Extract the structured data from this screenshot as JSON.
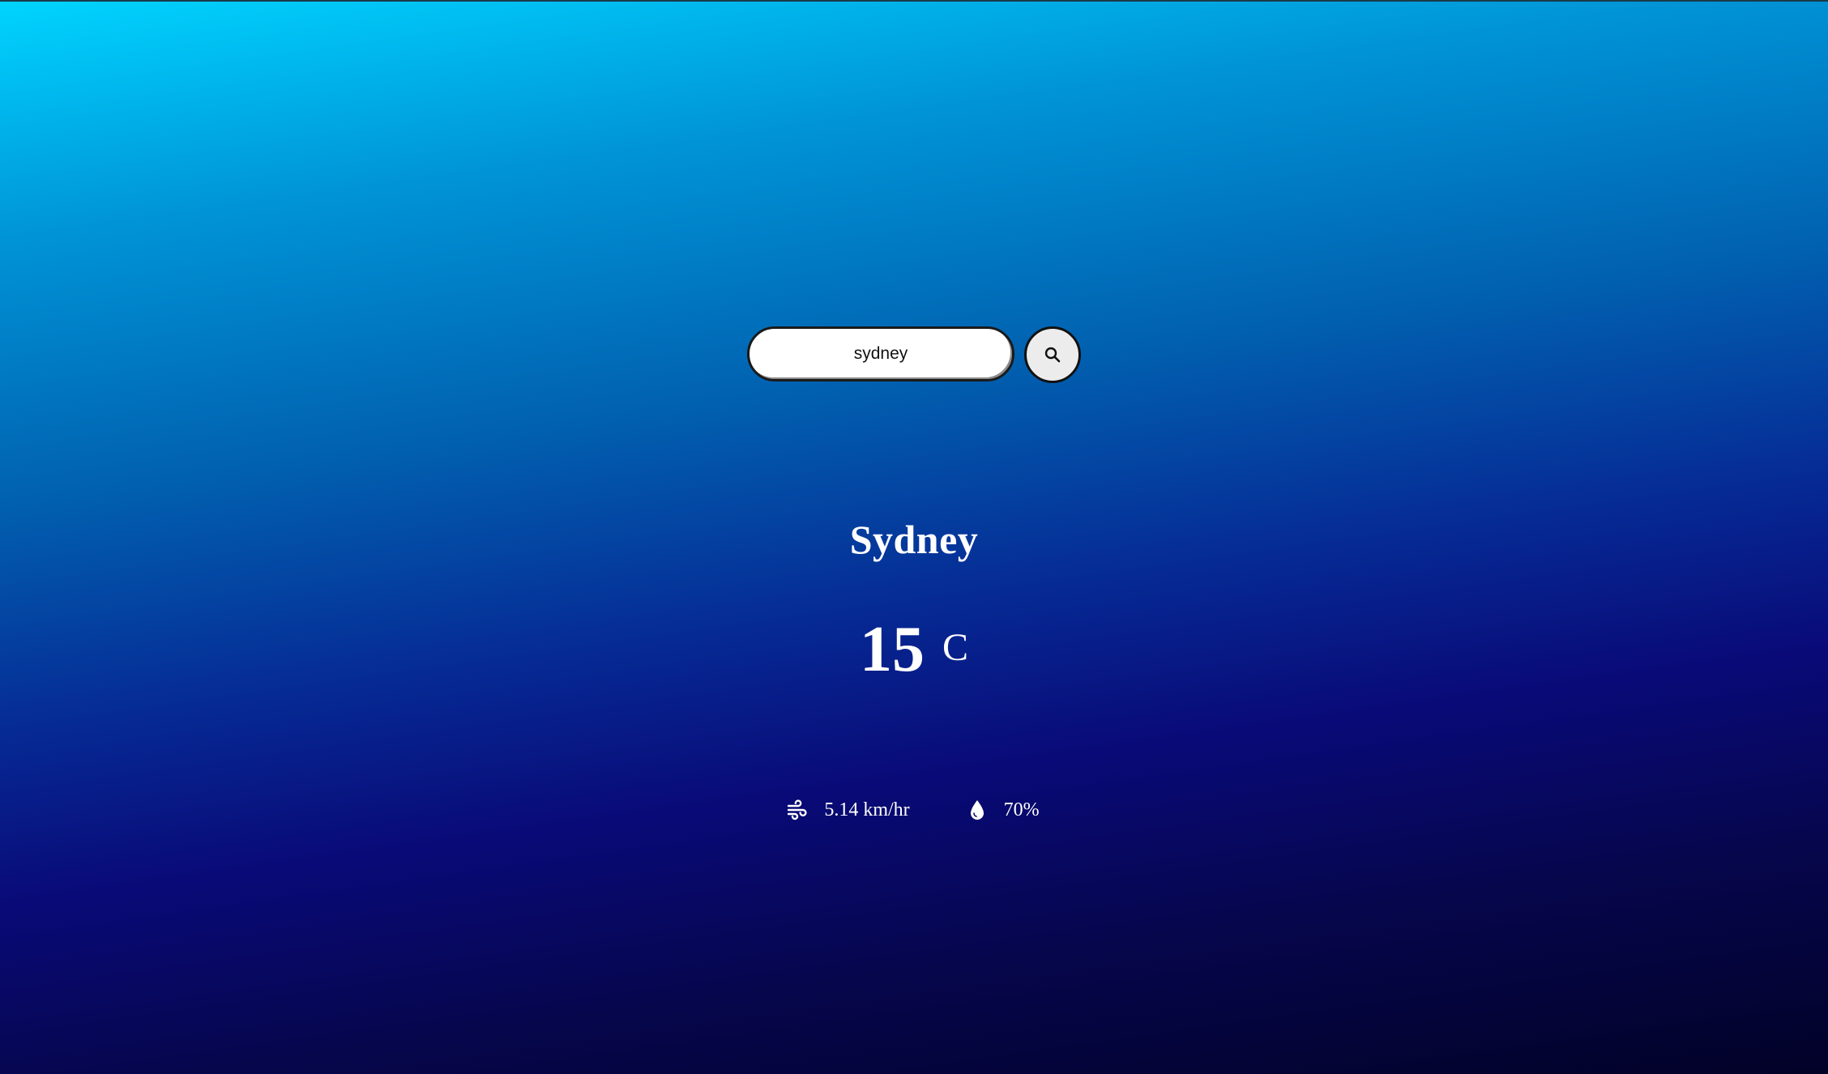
{
  "search": {
    "value": "sydney",
    "placeholder": "",
    "button_icon": "search-icon"
  },
  "weather": {
    "city": "Sydney",
    "temperature": "15",
    "unit": "C",
    "wind": {
      "icon": "wind-icon",
      "value": "5.14 km/hr"
    },
    "humidity": {
      "icon": "droplet-icon",
      "value": "70%"
    }
  },
  "colors": {
    "gradient_top": "#00d4ff",
    "gradient_mid": "#090a78",
    "gradient_bottom": "#020228",
    "text": "#ffffff"
  }
}
